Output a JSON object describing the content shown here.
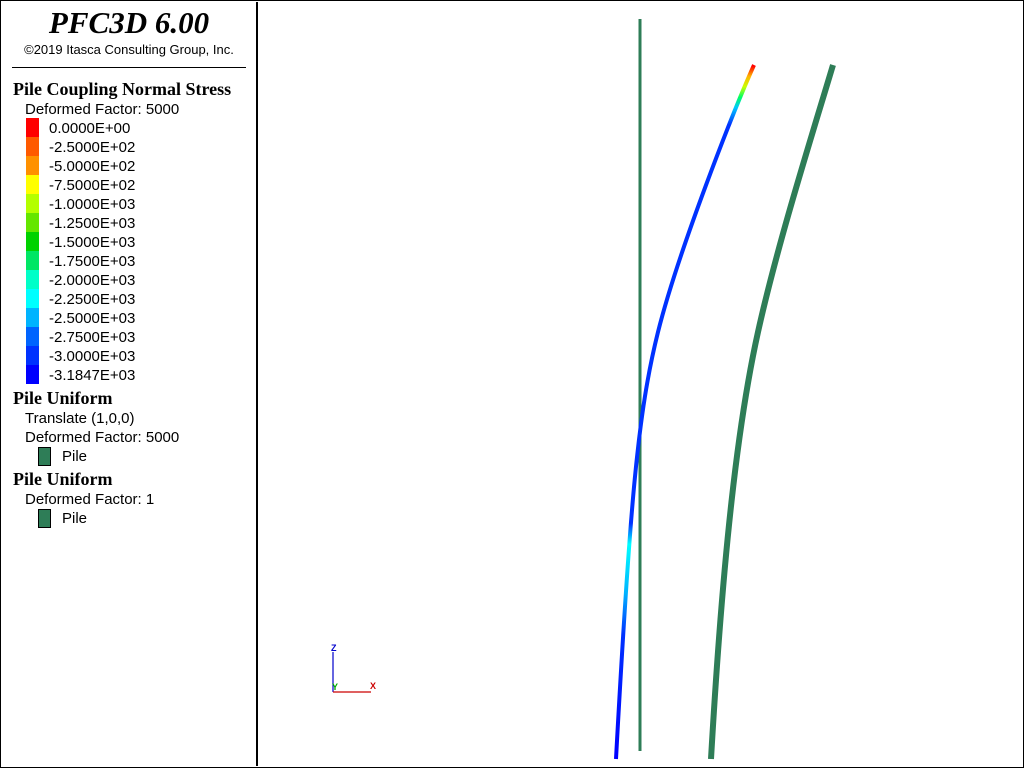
{
  "header": {
    "title": "PFC3D 6.00",
    "copyright": "©2019 Itasca Consulting Group, Inc."
  },
  "legend": {
    "stress": {
      "heading": "Pile Coupling Normal Stress",
      "deformed_factor": "Deformed Factor: 5000",
      "ticks": [
        "0.0000E+00",
        "-2.5000E+02",
        "-5.0000E+02",
        "-7.5000E+02",
        "-1.0000E+03",
        "-1.2500E+03",
        "-1.5000E+03",
        "-1.7500E+03",
        "-2.0000E+03",
        "-2.2500E+03",
        "-2.5000E+03",
        "-2.7500E+03",
        "-3.0000E+03",
        "-3.1847E+03"
      ],
      "colors": [
        "#ff0000",
        "#ff5a00",
        "#ff9100",
        "#ffff00",
        "#b4ff00",
        "#64e600",
        "#00d200",
        "#00e664",
        "#00ffc8",
        "#00ffff",
        "#00b4ff",
        "#0064ff",
        "#0032ff",
        "#0000ff"
      ]
    },
    "uniform1": {
      "heading": "Pile Uniform",
      "translate": "Translate (1,0,0)",
      "deformed_factor": "Deformed Factor: 5000",
      "item_label": "Pile",
      "color": "#2e7d57"
    },
    "uniform2": {
      "heading": "Pile Uniform",
      "deformed_factor": "Deformed Factor: 1",
      "item_label": "Pile",
      "color": "#2e7d57"
    }
  },
  "axes": {
    "z_label": "Z",
    "y_label": "Y",
    "x_label": "X",
    "z_color": "#0000cc",
    "y_color": "#00aa00",
    "x_color": "#cc0000"
  },
  "piles": {
    "original_color": "#2e7d57",
    "translated_color": "#2e7d57"
  }
}
